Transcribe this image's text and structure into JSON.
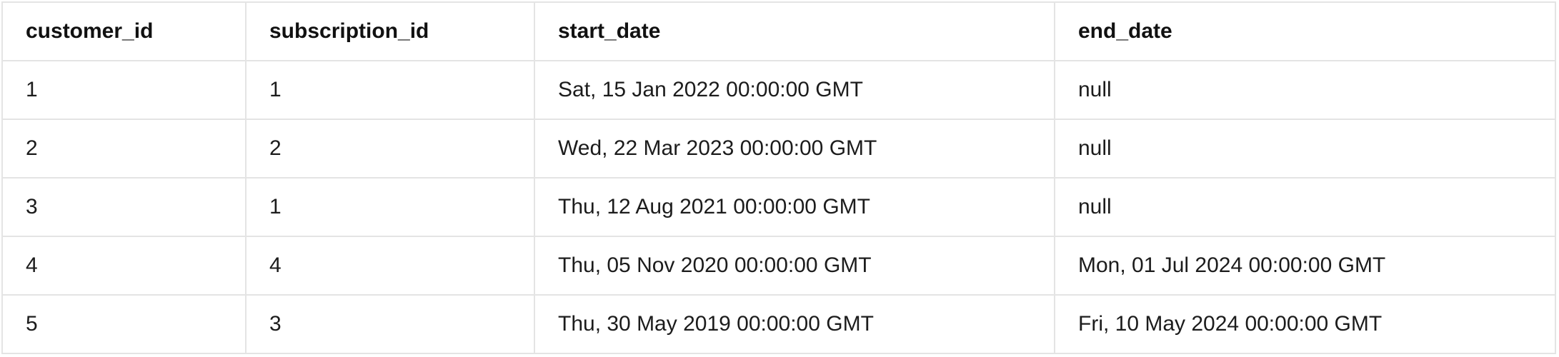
{
  "table": {
    "columns": [
      "customer_id",
      "subscription_id",
      "start_date",
      "end_date"
    ],
    "rows": [
      [
        "1",
        "1",
        "Sat, 15 Jan 2022 00:00:00 GMT",
        "null"
      ],
      [
        "2",
        "2",
        "Wed, 22 Mar 2023 00:00:00 GMT",
        "null"
      ],
      [
        "3",
        "1",
        "Thu, 12 Aug 2021 00:00:00 GMT",
        "null"
      ],
      [
        "4",
        "4",
        "Thu, 05 Nov 2020 00:00:00 GMT",
        "Mon, 01 Jul 2024 00:00:00 GMT"
      ],
      [
        "5",
        "3",
        "Thu, 30 May 2019 00:00:00 GMT",
        "Fri, 10 May 2024 00:00:00 GMT"
      ]
    ]
  }
}
